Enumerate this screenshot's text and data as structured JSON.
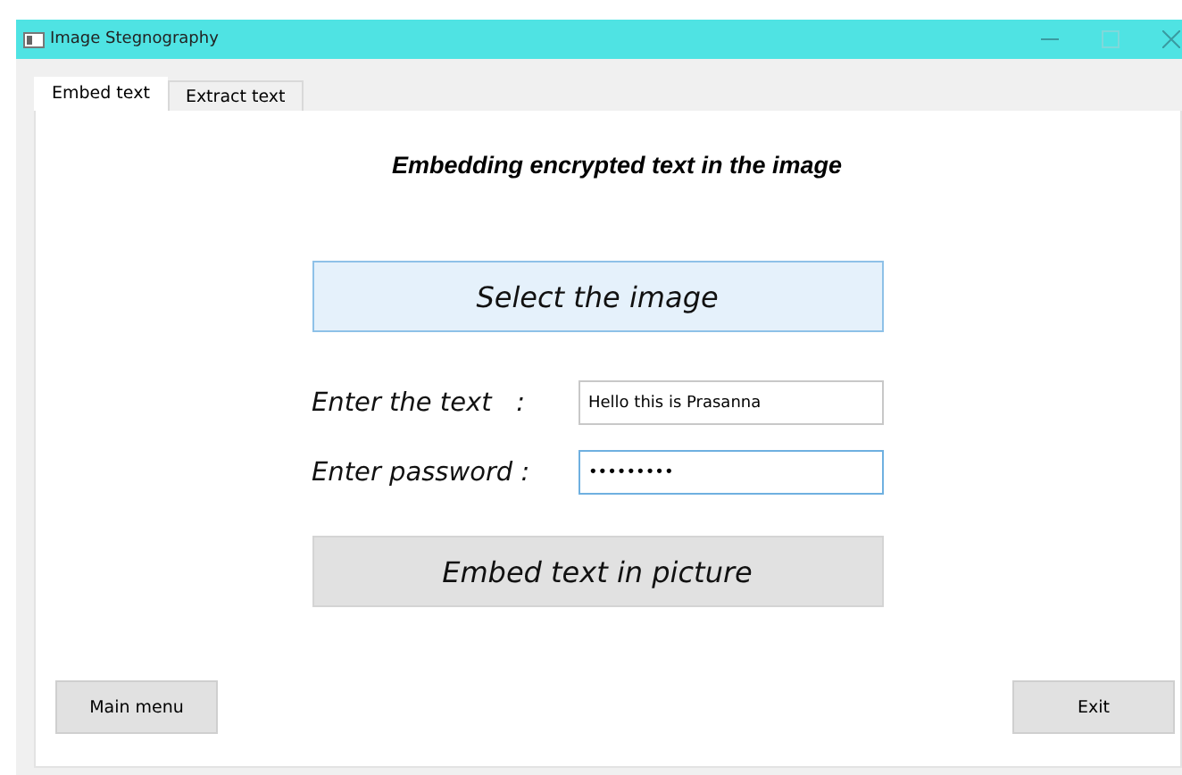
{
  "window": {
    "title": "Image Stegnography"
  },
  "tabs": [
    {
      "label": "Embed text",
      "selected": true
    },
    {
      "label": "Extract text",
      "selected": false
    }
  ],
  "heading": "Embedding encrypted text in the image",
  "select_button": "Select the image",
  "fields": [
    {
      "label": "Enter the text   :",
      "value": "Hello this is Prasanna",
      "focused": false
    },
    {
      "label": "Enter password :",
      "value": "•••••••••",
      "focused": true
    }
  ],
  "embed_button": "Embed text in picture",
  "footer_buttons": [
    "Main menu",
    "Exit"
  ]
}
